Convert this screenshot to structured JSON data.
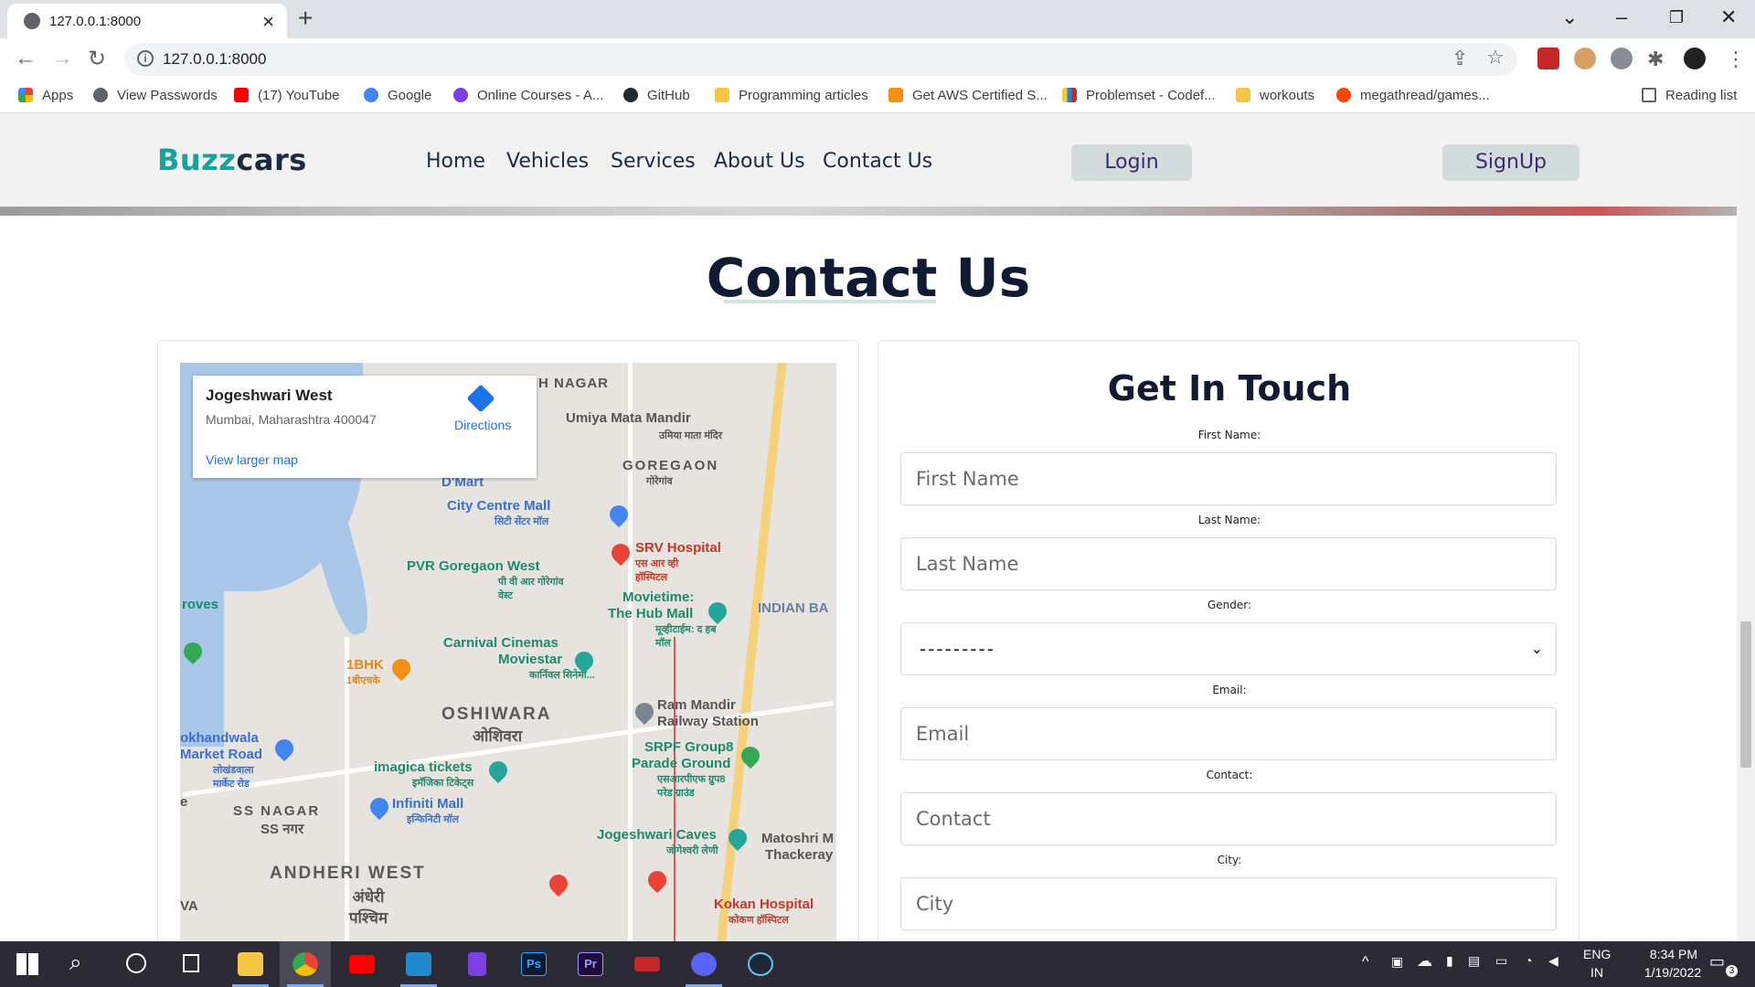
{
  "browser": {
    "tab_title": "127.0.0.1:8000",
    "url": "127.0.0.1:8000",
    "bookmarks": [
      {
        "label": "Apps",
        "color": "#ea4335"
      },
      {
        "label": "View Passwords",
        "color": "#5f6368"
      },
      {
        "label": "(17) YouTube",
        "color": "#ff0000"
      },
      {
        "label": "Google",
        "color": "#4285f4"
      },
      {
        "label": "Online Courses - A...",
        "color": "#7b3fe4"
      },
      {
        "label": "GitHub",
        "color": "#24292e"
      },
      {
        "label": "Programming articles",
        "color": "#f6c744"
      },
      {
        "label": "Get AWS Certified S...",
        "color": "#f29111"
      },
      {
        "label": "Problemset - Codef...",
        "color": "#1f8acb"
      },
      {
        "label": "workouts",
        "color": "#f6c744"
      },
      {
        "label": "megathread/games...",
        "color": "#ff4500"
      }
    ],
    "reading_list": "Reading list"
  },
  "site": {
    "logo_part1": "Buzz",
    "logo_part2": "cars",
    "nav": [
      "Home",
      "Vehicles",
      "Services",
      "About Us",
      "Contact Us"
    ],
    "login": "Login",
    "signup": "SignUp",
    "accent_color": "#16a39b"
  },
  "contact": {
    "title": "Contact Us",
    "map": {
      "popup_title": "Jogeshwari West",
      "popup_address": "Mumbai, Maharashtra 400047",
      "directions": "Directions",
      "view_larger": "View larger map",
      "labels": {
        "h_nagar": "H NAGAR",
        "umiya": "Umiya Mata Mandir",
        "umiya_hi": "उमिया माता मंदिर",
        "goregaon": "GOREGAON",
        "goregaon_hi": "गोरेगांव",
        "dmart": "D'Mart",
        "city_centre": "City Centre Mall",
        "city_centre_hi": "सिटी सेंटर मॉल",
        "srv": "SRV Hospital",
        "srv_hi": "एस आर व्ही हॉस्पिटल",
        "pvr": "PVR Goregaon West",
        "pvr_hi": "पी वी आर गोरेगांव वेस्ट",
        "movietime": "Movietime:",
        "hub_mall": "The Hub Mall",
        "hub_mall_hi": "मूव्हीटाईम: द हब मॉल",
        "indian_bank": "INDIAN BA",
        "groves": "roves",
        "carnival": "Carnival Cinemas",
        "moviestar": "Moviestar",
        "carnival_hi": "कार्निवल सिनेमा...",
        "bhk": "1BHK",
        "bhk_hi": "1बीएचके",
        "oshiwara": "OSHIWARA",
        "oshiwara_hi": "ओशिवरा",
        "ram_mandir": "Ram Mandir",
        "ram_mandir2": "Railway Station",
        "lokhandwala": "okhandwala",
        "market_road": "Market Road",
        "lokhandwala_hi": "लोखंडवाला मार्केट रोड",
        "srpf": "SRPF Group8",
        "parade": "Parade Ground",
        "srpf_hi": "एसआरपीएफ ग्रुप8 परेड ग्राउंड",
        "imagica": "imagica tickets",
        "imagica_hi": "इमॅजिका टिकेट्स",
        "infiniti": "Infiniti Mall",
        "infiniti_hi": "इन्फिनिटी मॉल",
        "ss_nagar": "SS NAGAR",
        "ss_nagar_hi": "SS नगर",
        "jog_caves": "Jogeshwari Caves",
        "jog_caves_hi": "जोगेश्वरी लेणी",
        "matoshri": "Matoshri M",
        "thackeray": "Thackeray",
        "andheri": "ANDHERI WEST",
        "andheri_hi": "अंधेरी पश्चिम",
        "kokan": "Kokan Hospital",
        "kokan_hi": "कोकण हॉस्पिटल",
        "va": "VA",
        "e": "e"
      }
    },
    "form": {
      "title": "Get In Touch",
      "first_name_label": "First Name:",
      "first_name_placeholder": "First Name",
      "last_name_label": "Last Name:",
      "last_name_placeholder": "Last Name",
      "gender_label": "Gender:",
      "gender_value": "---------",
      "email_label": "Email:",
      "email_placeholder": "Email",
      "contact_label": "Contact:",
      "contact_placeholder": "Contact",
      "city_label": "City:",
      "city_placeholder": "City"
    }
  },
  "taskbar": {
    "lang1": "ENG",
    "lang2": "IN",
    "time": "8:34 PM",
    "date": "1/19/2022",
    "notifications": "3"
  }
}
